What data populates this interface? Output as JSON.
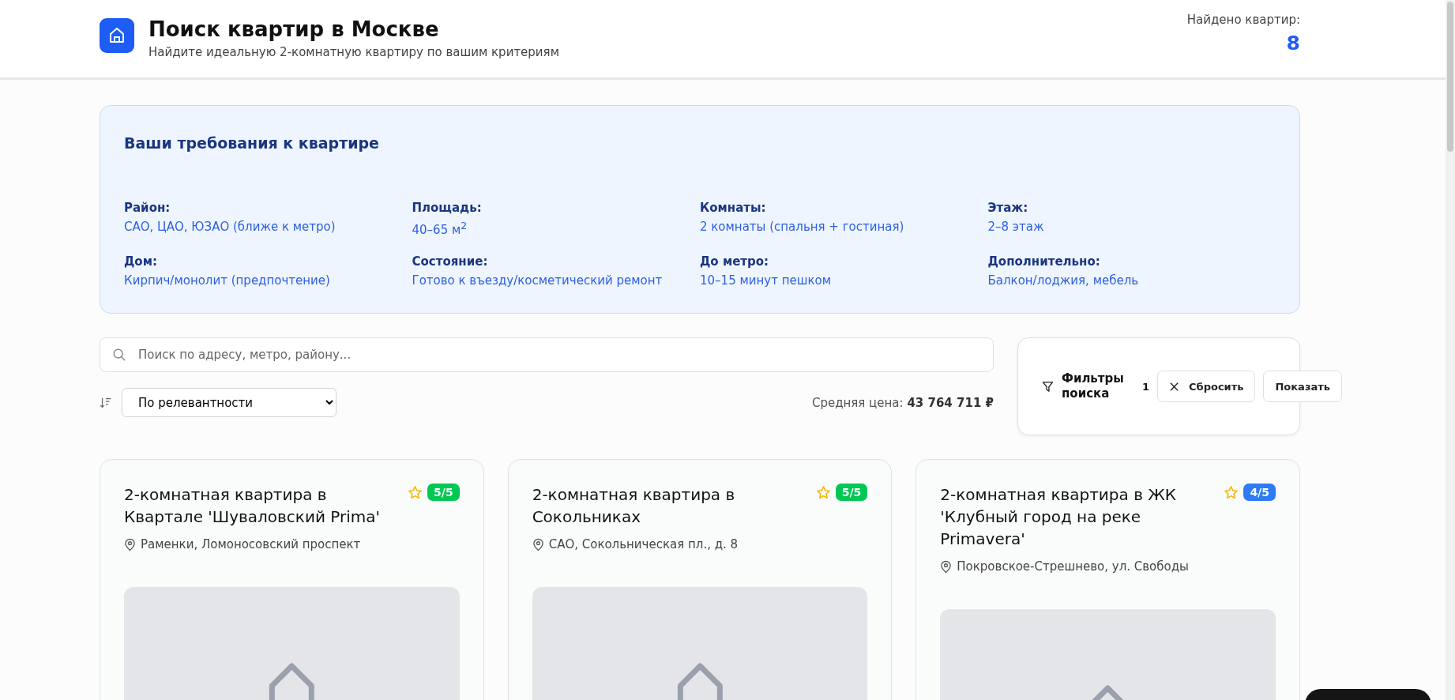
{
  "header": {
    "title": "Поиск квартир в Москве",
    "subtitle": "Найдите идеальную 2-комнатную квартиру по вашим критериям",
    "found_label": "Найдено квартир:",
    "found_count": "8"
  },
  "requirements": {
    "title": "Ваши требования к квартире",
    "items": [
      {
        "label": "Район:",
        "value": "САО, ЦАО, ЮЗАО (ближе к метро)"
      },
      {
        "label": "Площадь:",
        "value": "40–65 м$^{2}$"
      },
      {
        "label": "Комнаты:",
        "value": "2 комнаты (спальня + гостиная)"
      },
      {
        "label": "Этаж:",
        "value": "2–8 этаж"
      },
      {
        "label": "Дом:",
        "value": "Кирпич/монолит (предпочтение)"
      },
      {
        "label": "Состояние:",
        "value": "Готово к въезду/косметический ремонт"
      },
      {
        "label": "До метро:",
        "value": "10–15 минут пешком"
      },
      {
        "label": "Дополнительно:",
        "value": "Балкон/лоджия, мебель"
      }
    ]
  },
  "search": {
    "placeholder": "Поиск по адресу, метро, району..."
  },
  "sort": {
    "value": "По релевантности"
  },
  "average_price": {
    "label": "Средняя цена:",
    "value": "43 764 711 ₽"
  },
  "filters": {
    "title": "Фильтры поиска",
    "count": "1",
    "reset": "Сбросить",
    "show": "Показать"
  },
  "listings": [
    {
      "title": "2-комнатная квартира в Квартале 'Шуваловский Prima'",
      "address": "Раменки, Ломоносовский проспект",
      "score": "5/5",
      "color": "#00c853",
      "kind": "picture"
    },
    {
      "title": "2-комнатная квартира в Сокольниках",
      "address": "САО, Сокольническая пл., д. 8",
      "score": "5/5",
      "color": "#00c853",
      "kind": "picture"
    },
    {
      "title": "2-комнатная квартира в ЖК 'Клубный город на реке Primavera'",
      "address": "Покровское-Стрешнево, ул. Свободы",
      "score": "4/5",
      "color": "#2f7bf5",
      "kind": "picture"
    }
  ]
}
